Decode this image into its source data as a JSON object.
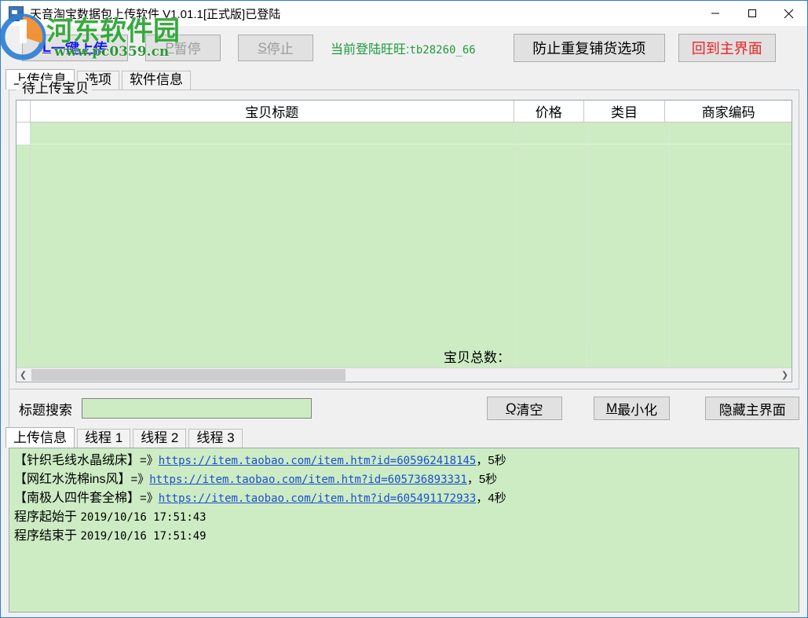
{
  "window": {
    "title": "天音淘宝数据包上传软件 V1.01.1[正式版]已登陆",
    "icon": "app-icon",
    "controls": {
      "minimize": "minimize-icon",
      "maximize": "maximize-icon",
      "close": "close-icon"
    }
  },
  "watermark": {
    "site_name": "河东软件园",
    "site_url": "www.pc0359.cn",
    "color": "#2aa331"
  },
  "toolbar": {
    "upload_accel": "L",
    "upload_label": "一键上传",
    "pause_accel": "P",
    "pause_label": "暂停",
    "stop_accel": "S",
    "stop_label": "停止",
    "login_prefix": "当前登陆旺旺:",
    "login_account": "tb28260_66",
    "login_color": "#1d9b3c",
    "prevent_duplicate_label": "防止重复铺货选项",
    "back_home_label": "回到主界面",
    "back_home_color": "#ee2020"
  },
  "main_tabs": [
    {
      "label": "上传信息",
      "active": true
    },
    {
      "label": "选项",
      "active": false
    },
    {
      "label": "软件信息",
      "active": false
    }
  ],
  "groupbox": {
    "label": "待上传宝贝"
  },
  "grid": {
    "columns": [
      "宝贝标题",
      "价格",
      "类目",
      "商家编码"
    ],
    "rows": [],
    "total_label": "宝贝总数：",
    "total_value": "",
    "background_color": "#cdecc4",
    "hscroll": {
      "left_arrow": "chevron-left-icon",
      "right_arrow": "chevron-right-icon",
      "thumb_percent": 42
    }
  },
  "search": {
    "label": "标题搜索",
    "value": "",
    "placeholder": "",
    "clear_accel": "Q",
    "clear_label": "清空",
    "minimize_accel": "M",
    "minimize_label": "最小化",
    "hide_label": "隐藏主界面"
  },
  "log_tabs": [
    {
      "label": "上传信息",
      "active": true
    },
    {
      "label": "线程 1",
      "active": false
    },
    {
      "label": "线程 2",
      "active": false
    },
    {
      "label": "线程 3",
      "active": false
    }
  ],
  "log": {
    "entries": [
      {
        "item": "【针织毛线水晶绒床】",
        "arrow": "=》",
        "url": "https://item.taobao.com/item.htm?id=605962418145",
        "tail": "，5秒"
      },
      {
        "item": "【网红水洗棉ins风】",
        "arrow": "=》",
        "url": "https://item.taobao.com/item.htm?id=605736893331",
        "tail": "，5秒"
      },
      {
        "item": "【南极人四件套全棉】",
        "arrow": "=》",
        "url": "https://item.taobao.com/item.htm?id=605491172933",
        "tail": "，4秒"
      }
    ],
    "start_label": "程序起始于",
    "start_time": "2019/10/16 17:51:43",
    "end_label": "程序结束于",
    "end_time": "2019/10/16 17:51:49"
  }
}
